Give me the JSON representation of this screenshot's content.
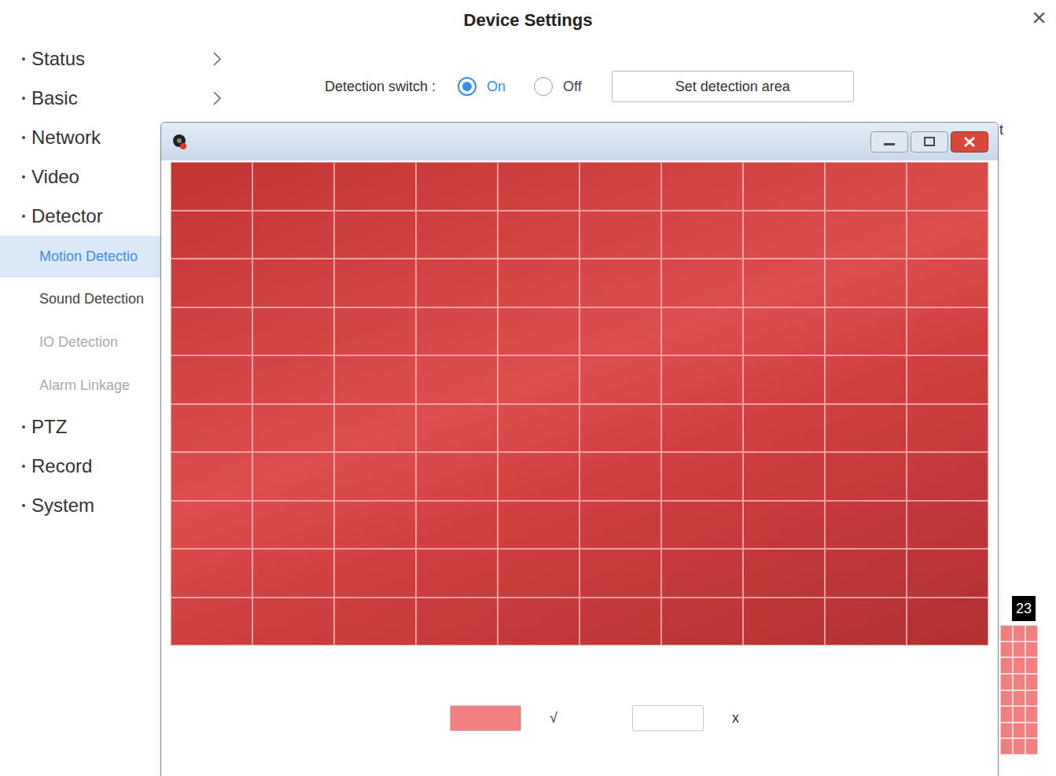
{
  "window": {
    "title": "Device Settings",
    "close": "×"
  },
  "sidebar": {
    "items": [
      {
        "label": "Status",
        "kind": "section",
        "has_arrow": true,
        "selected": false,
        "disabled": false
      },
      {
        "label": "Basic",
        "kind": "section",
        "has_arrow": true,
        "selected": false,
        "disabled": false
      },
      {
        "label": "Network",
        "kind": "section",
        "has_arrow": false,
        "selected": false,
        "disabled": false
      },
      {
        "label": "Video",
        "kind": "section",
        "has_arrow": false,
        "selected": false,
        "disabled": false
      },
      {
        "label": "Detector",
        "kind": "section",
        "has_arrow": false,
        "selected": false,
        "disabled": false
      },
      {
        "label": "Motion Detectio",
        "kind": "sub",
        "has_arrow": false,
        "selected": true,
        "disabled": false
      },
      {
        "label": "Sound Detection",
        "kind": "sub",
        "has_arrow": false,
        "selected": false,
        "disabled": false
      },
      {
        "label": "IO Detection",
        "kind": "sub",
        "has_arrow": false,
        "selected": false,
        "disabled": true
      },
      {
        "label": "Alarm Linkage",
        "kind": "sub",
        "has_arrow": false,
        "selected": false,
        "disabled": true
      },
      {
        "label": "PTZ",
        "kind": "section",
        "has_arrow": false,
        "selected": false,
        "disabled": false
      },
      {
        "label": "Record",
        "kind": "section",
        "has_arrow": false,
        "selected": false,
        "disabled": false
      },
      {
        "label": "System",
        "kind": "section",
        "has_arrow": false,
        "selected": false,
        "disabled": false
      }
    ]
  },
  "detection": {
    "label": "Detection switch :",
    "options": [
      {
        "label": "On",
        "selected": true
      },
      {
        "label": "Off",
        "selected": false
      }
    ],
    "button": "Set detection area"
  },
  "area_window": {
    "grid": [
      [
        true,
        true,
        true,
        true,
        true,
        true,
        true,
        true,
        true,
        true
      ],
      [
        true,
        true,
        true,
        true,
        true,
        true,
        true,
        true,
        true,
        true
      ],
      [
        true,
        true,
        true,
        true,
        true,
        true,
        true,
        true,
        true,
        true
      ],
      [
        true,
        true,
        true,
        true,
        true,
        true,
        true,
        true,
        true,
        true
      ],
      [
        true,
        true,
        true,
        true,
        true,
        true,
        true,
        true,
        true,
        true
      ],
      [
        true,
        true,
        true,
        true,
        true,
        true,
        true,
        true,
        true,
        true
      ],
      [
        true,
        true,
        true,
        true,
        true,
        true,
        true,
        true,
        true,
        true
      ],
      [
        true,
        true,
        true,
        true,
        true,
        true,
        true,
        true,
        true,
        true
      ],
      [
        true,
        true,
        true,
        true,
        true,
        true,
        true,
        true,
        true,
        true
      ],
      [
        true,
        true,
        true,
        true,
        true,
        true,
        true,
        true,
        true,
        true
      ]
    ],
    "legend": [
      {
        "label": "√",
        "color": "#f28080"
      },
      {
        "label": "x",
        "color": "#ffffff"
      }
    ]
  },
  "background": {
    "label_fragment": "t",
    "schedule_hour": "23"
  }
}
